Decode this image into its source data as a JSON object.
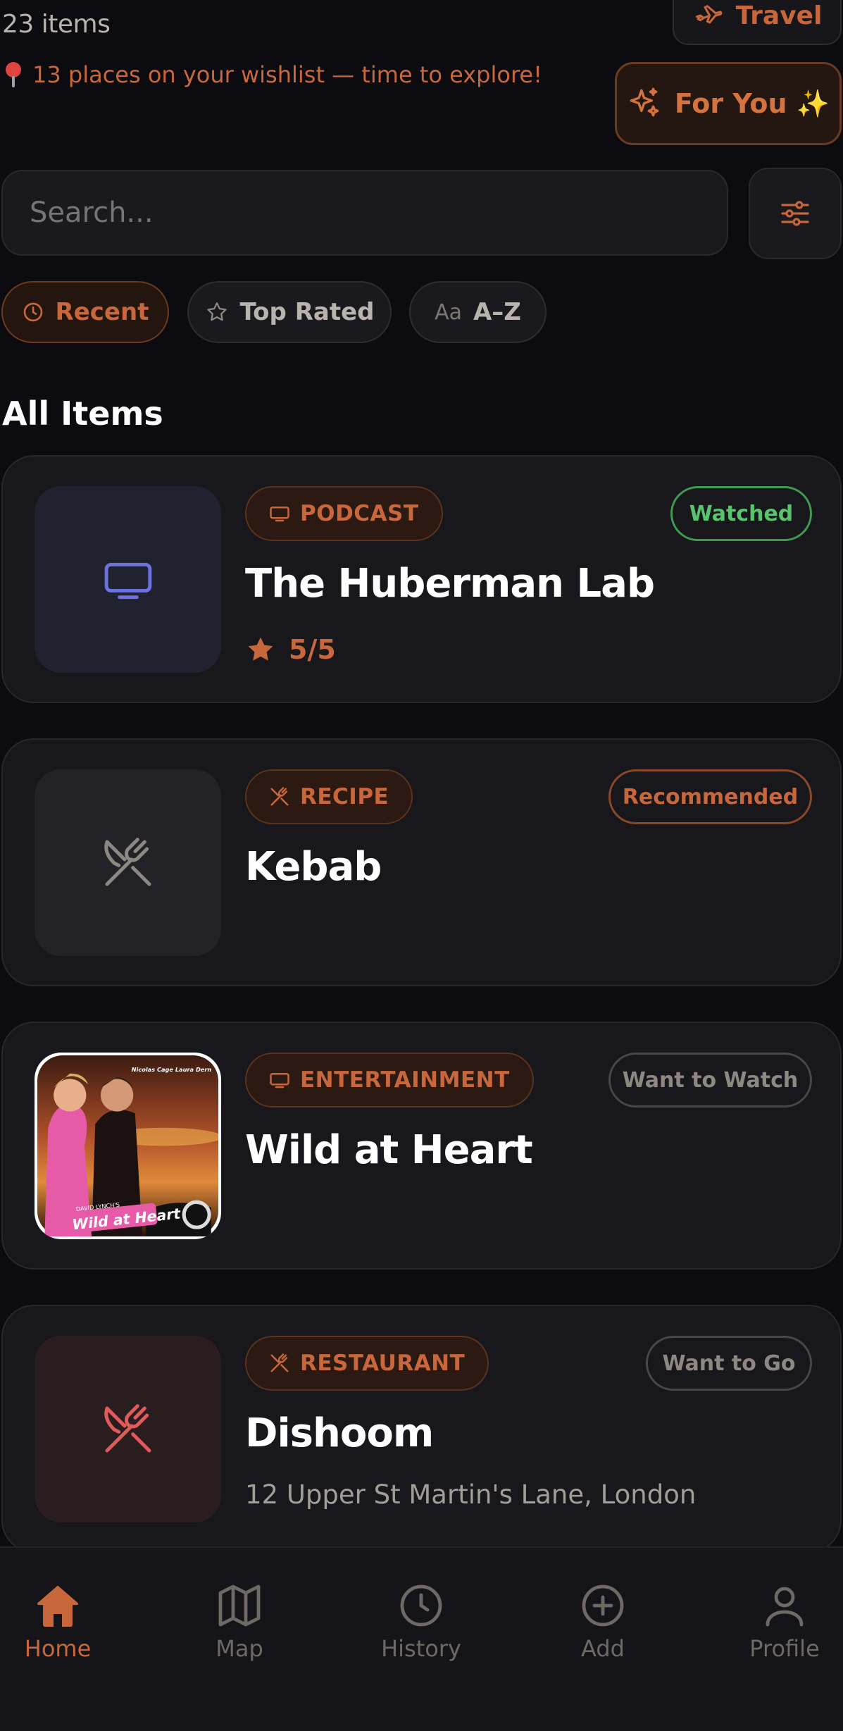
{
  "header": {
    "item_count": "23 items",
    "wishlist_text": "13 places on your wishlist — time to explore!",
    "travel_label": "Travel",
    "for_you_label": "For You ✨"
  },
  "search": {
    "placeholder": "Search..."
  },
  "sort_chips": [
    {
      "label": "Recent",
      "icon": "clock-icon",
      "active": true
    },
    {
      "label": "Top Rated",
      "icon": "star-outline-icon",
      "active": false
    },
    {
      "label": "A–Z",
      "icon_text": "Aa",
      "active": false
    }
  ],
  "section_title": "All Items",
  "items": [
    {
      "category": "PODCAST",
      "category_icon": "tv-icon",
      "status": "Watched",
      "title": "The Huberman Lab",
      "rating": "5/5",
      "thumb_icon": "tv-icon"
    },
    {
      "category": "RECIPE",
      "category_icon": "utensils-icon",
      "status": "Recommended",
      "title": "Kebab",
      "thumb_icon": "utensils-icon"
    },
    {
      "category": "ENTERTAINMENT",
      "category_icon": "tv-icon",
      "status": "Want to Watch",
      "title": "Wild at Heart",
      "poster_text": {
        "cast": "Nicolas Cage  Laura Dern",
        "title": "Wild at Heart",
        "credit": "DAVID LYNCH'S"
      }
    },
    {
      "category": "RESTAURANT",
      "category_icon": "utensils-icon",
      "status": "Want to Go",
      "title": "Dishoom",
      "address": "12 Upper St Martin's Lane, London",
      "thumb_icon": "utensils-icon"
    }
  ],
  "nav": [
    {
      "label": "Home",
      "icon": "home-icon",
      "active": true
    },
    {
      "label": "Map",
      "icon": "map-icon",
      "active": false
    },
    {
      "label": "History",
      "icon": "clock-icon",
      "active": false
    },
    {
      "label": "Add",
      "icon": "plus-circle-icon",
      "active": false
    },
    {
      "label": "Profile",
      "icon": "user-icon",
      "active": false
    }
  ],
  "colors": {
    "accent": "#c8663c",
    "background": "#0c0b0f",
    "card": "#18171c",
    "watched_green": "#58c46e"
  }
}
